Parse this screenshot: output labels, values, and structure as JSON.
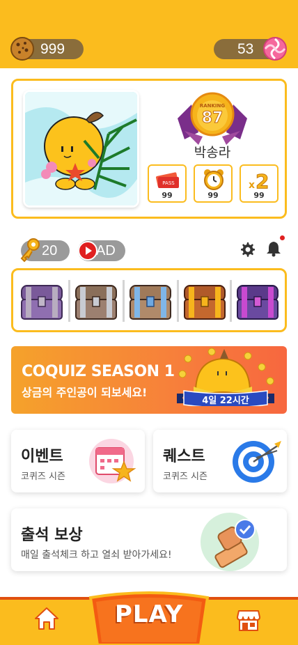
{
  "header": {
    "coins": "999",
    "candy": "53"
  },
  "profile": {
    "ranking_label": "RANKING",
    "ranking_value": "87",
    "name": "박송라",
    "items": [
      {
        "icon": "pass-ticket-icon",
        "count": "99"
      },
      {
        "icon": "alarm-clock-icon",
        "count": "99"
      },
      {
        "icon": "double-x2-icon",
        "label": "x2",
        "count": "99"
      }
    ]
  },
  "resources": {
    "keys": "20",
    "ad_label": "AD"
  },
  "chests": [
    "purple-chest-icon",
    "gray-chest-icon",
    "blue-chest-icon",
    "orange-chest-icon",
    "violet-chest-icon"
  ],
  "season": {
    "title": "COQUIZ SEASON 1",
    "subtitle": "상금의 주인공이 되보세요!",
    "timer": "4일 22시간"
  },
  "cards": {
    "event": {
      "title": "이벤트",
      "subtitle": "코퀴즈 시즌"
    },
    "quest": {
      "title": "퀘스트",
      "subtitle": "코퀴즈 시즌"
    },
    "attendance": {
      "title": "출석 보상",
      "subtitle": "매일 출석체크 하고 열쇠 받아가세요!"
    }
  },
  "nav": {
    "play_label": "PLAY"
  },
  "colors": {
    "brand_yellow": "#fbbc1e",
    "nav_border": "#e04f10",
    "pill_gray": "#9a9a9a",
    "coin_pill": "#8a6d3b"
  }
}
